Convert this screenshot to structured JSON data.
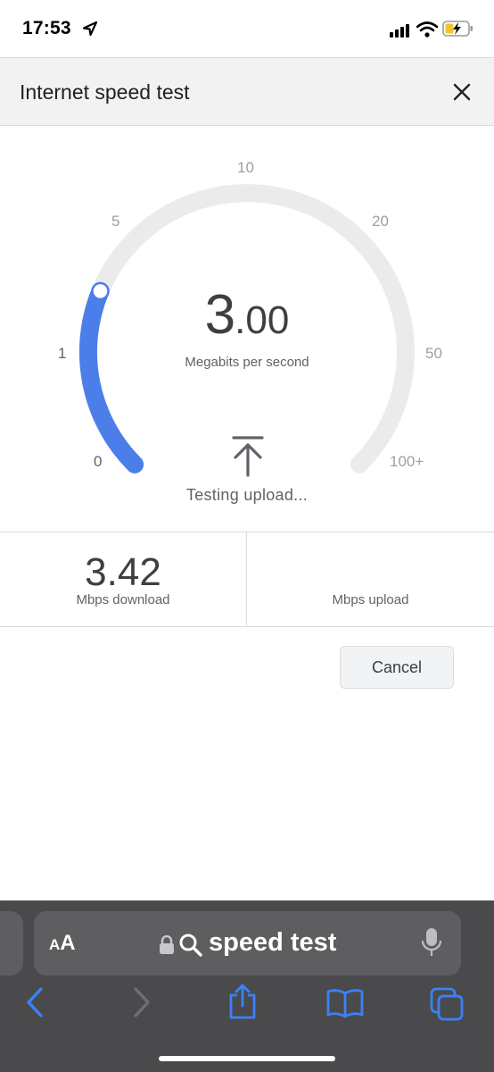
{
  "status_bar": {
    "time": "17:53",
    "icons": [
      "location-arrow-icon",
      "cellular-signal-icon",
      "wifi-icon",
      "battery-charging-icon"
    ]
  },
  "header": {
    "title": "Internet speed test",
    "close_icon": "close-icon"
  },
  "gauge": {
    "scale_labels": [
      "0",
      "1",
      "5",
      "10",
      "20",
      "50",
      "100+"
    ],
    "current_speed_int": "3",
    "current_speed_frac": ".00",
    "unit": "Megabits per second",
    "progress_speed_mbps": 3.0,
    "status": "Testing upload...",
    "status_icon": "upload-arrow-icon",
    "track_color": "#ebebeb",
    "fill_color": "#4b7ee8"
  },
  "results": {
    "download_value": "3.42",
    "download_label": "Mbps download",
    "upload_value": "",
    "upload_label": "Mbps upload"
  },
  "actions": {
    "cancel_label": "Cancel"
  },
  "browser": {
    "text_size_label_small": "A",
    "text_size_label_large": "A",
    "address_text": "speed test",
    "address_icons": [
      "lock-icon",
      "search-icon",
      "microphone-icon"
    ],
    "toolbar_icons": [
      "back-icon",
      "forward-icon",
      "share-icon",
      "bookmarks-icon",
      "tabs-icon"
    ],
    "accent_color": "#3a82f7"
  }
}
